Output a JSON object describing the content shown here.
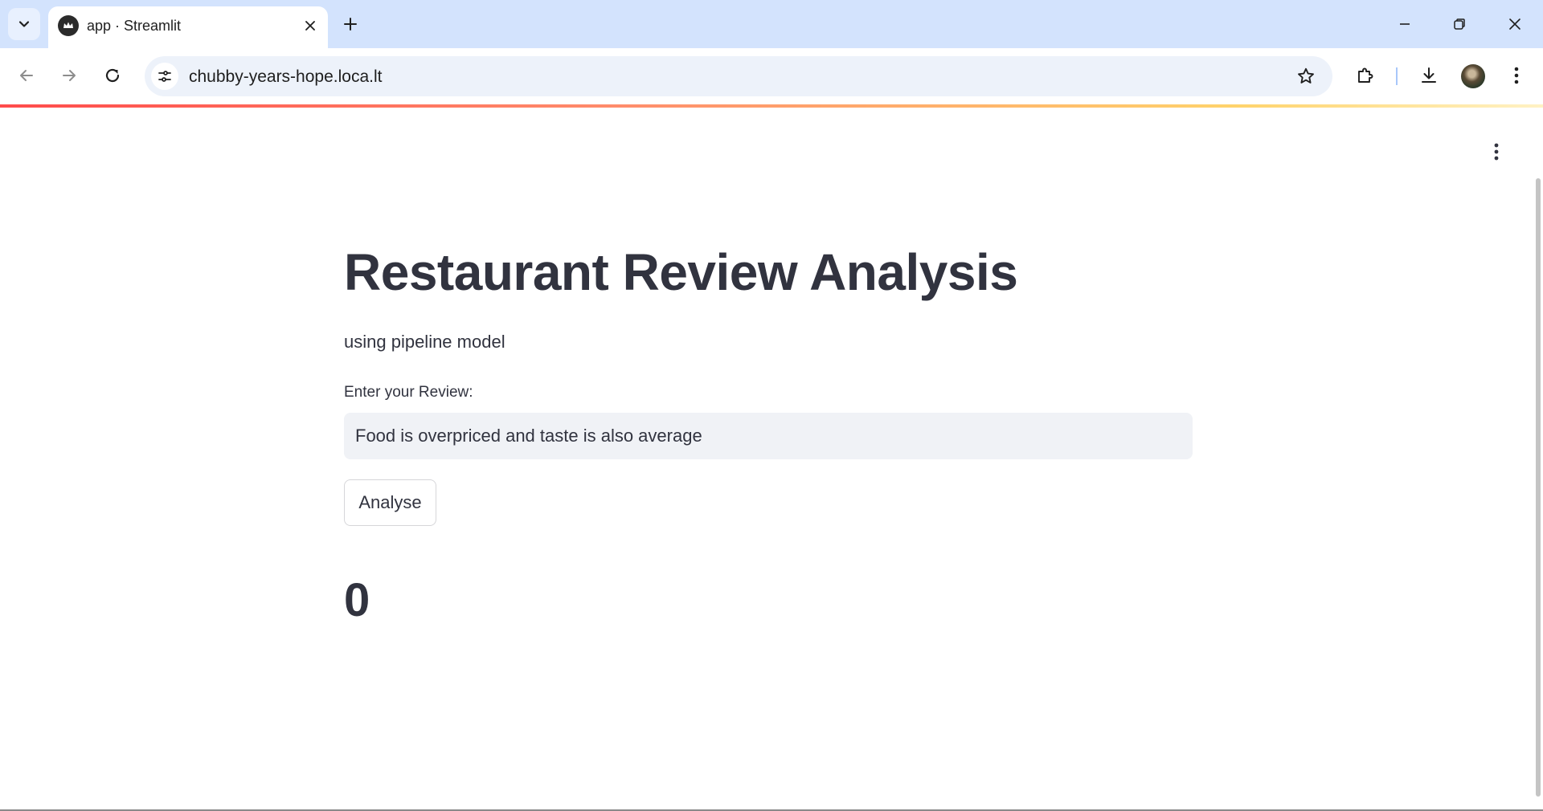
{
  "browser": {
    "tab": {
      "title": "app · Streamlit"
    },
    "url": "chubby-years-hope.loca.lt",
    "icons": {
      "tab_search": "chevron-down-icon",
      "favicon": "streamlit-crown-icon",
      "tab_close": "close-icon",
      "new_tab": "plus-icon",
      "minimize": "minimize-icon",
      "restore": "restore-icon",
      "close_window": "close-icon",
      "back": "arrow-left-icon",
      "forward": "arrow-right-icon",
      "reload": "reload-icon",
      "site_info": "tune-icon",
      "bookmark": "star-icon",
      "extensions": "puzzle-icon",
      "downloads": "download-icon",
      "menu": "kebab-vertical-icon"
    },
    "colors": {
      "tabstrip": "#d3e3fd",
      "omnibox": "#edf2fa"
    }
  },
  "app": {
    "title": "Restaurant Review Analysis",
    "subtitle": "using pipeline model",
    "review_label": "Enter your Review:",
    "review_value": "Food is overpriced and taste is also average",
    "analyse_button": "Analyse",
    "result": "0",
    "colors": {
      "text": "#31333f",
      "input_bg": "#f0f2f6",
      "accent": "#ff4b4b"
    }
  }
}
